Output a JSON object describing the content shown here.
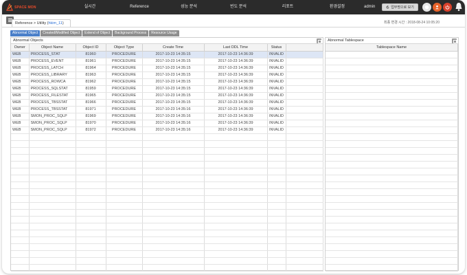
{
  "nav": {
    "logo_text": "SPACE MON",
    "items": [
      "실시간",
      "Reference",
      "성능 분석",
      "빈도 분석",
      "리포트",
      "환경설정"
    ],
    "user": "admin",
    "new_window_label": "업무명으로 보기"
  },
  "breadcrumb": {
    "path": "Reference > Utility (",
    "db": "hkim_11",
    "close": ")",
    "update_time": "최종 변경 시간 : 2018-08-24 10:05:20"
  },
  "subtabs": [
    "Abnormal Object",
    "Created/Modified Object",
    "Extend of Object",
    "Background Process",
    "Resource Usage"
  ],
  "left_panel": {
    "title": "Abnormal Objects",
    "columns": [
      "Owner",
      "Object Name",
      "Object ID",
      "Object Type",
      "Create Time",
      "Last DDL Time",
      "Status"
    ],
    "rows": [
      [
        "WEB",
        "PROCESS_STAT",
        "81960",
        "PROCEDURE",
        "2017-10-23 14:35:15",
        "2017-10-23 14:36:39",
        "INVALID"
      ],
      [
        "WEB",
        "PROCESS_EVENT",
        "81961",
        "PROCEDURE",
        "2017-10-23 14:35:15",
        "2017-10-23 14:36:39",
        "INVALID"
      ],
      [
        "WEB",
        "PROCESS_LATCH",
        "81964",
        "PROCEDURE",
        "2017-10-23 14:35:15",
        "2017-10-23 14:36:39",
        "INVALID"
      ],
      [
        "WEB",
        "PROCESS_LIBRARY",
        "81963",
        "PROCEDURE",
        "2017-10-23 14:35:15",
        "2017-10-23 14:36:39",
        "INVALID"
      ],
      [
        "WEB",
        "PROCESS_ROWCA",
        "81962",
        "PROCEDURE",
        "2017-10-23 14:35:15",
        "2017-10-23 14:36:39",
        "INVALID"
      ],
      [
        "WEB",
        "PROCESS_SQLSTAT",
        "81959",
        "PROCEDURE",
        "2017-10-23 14:35:15",
        "2017-10-23 14:36:39",
        "INVALID"
      ],
      [
        "WEB",
        "PROCESS_FILESTAT",
        "81965",
        "PROCEDURE",
        "2017-10-23 14:35:15",
        "2017-10-23 14:36:39",
        "INVALID"
      ],
      [
        "WEB",
        "PROCESS_TBSSTAT",
        "81966",
        "PROCEDURE",
        "2017-10-23 14:35:15",
        "2017-10-23 14:36:39",
        "INVALID"
      ],
      [
        "WEB",
        "PROCESS_TBSSTAT",
        "81971",
        "PROCEDURE",
        "2017-10-23 14:35:16",
        "2017-10-23 14:36:39",
        "INVALID"
      ],
      [
        "WEB",
        "SMON_PROC_SQLP",
        "81969",
        "PROCEDURE",
        "2017-10-23 14:35:16",
        "2017-10-23 14:36:39",
        "INVALID"
      ],
      [
        "WEB",
        "SMON_PROC_SQLP",
        "81970",
        "PROCEDURE",
        "2017-10-23 14:35:16",
        "2017-10-23 14:36:39",
        "INVALID"
      ],
      [
        "WEB",
        "SMON_PROC_SQLP",
        "81972",
        "PROCEDURE",
        "2017-10-23 14:35:16",
        "2017-10-23 14:36:39",
        "INVALID"
      ]
    ]
  },
  "right_panel": {
    "title": "Abnormal Tablespace",
    "columns": [
      "Tablespace Name"
    ]
  },
  "colors": {
    "topbar": "#2b2b2b",
    "accent_blue": "#4a7fc9",
    "logo_red": "#e94b2a",
    "btn_orange": "#e8632a",
    "btn_red": "#d9412b"
  }
}
